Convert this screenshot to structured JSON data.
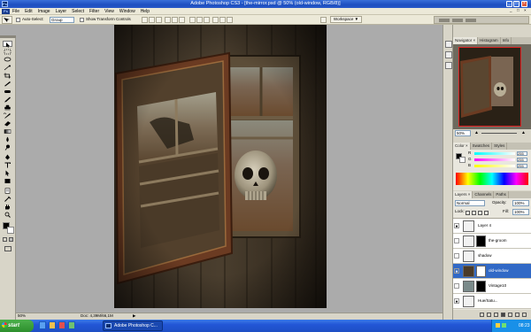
{
  "window": {
    "title": "Adobe Photoshop CS3 - [the-mirror.psd @ 50% (old-window, RGB/8)]",
    "controls": [
      "_",
      "□",
      "×"
    ]
  },
  "menubar": {
    "logo": "Ps",
    "items": [
      "File",
      "Edit",
      "Image",
      "Layer",
      "Select",
      "Filter",
      "View",
      "Window",
      "Help"
    ],
    "doc_controls": [
      "_",
      "□",
      "×"
    ]
  },
  "options": {
    "auto_select_label": "Auto-Select:",
    "auto_select_value": "Group",
    "transform_label": "Show Transform Controls",
    "workspace_label": "Workspace ▼"
  },
  "tools": {
    "icons": [
      "move-icon",
      "marquee-icon",
      "lasso-icon",
      "magic-wand-icon",
      "crop-icon",
      "eyedropper-icon",
      "healing-icon",
      "brush-icon",
      "clone-stamp-icon",
      "history-brush-icon",
      "eraser-icon",
      "gradient-icon",
      "blur-icon",
      "dodge-icon",
      "pen-icon",
      "type-icon",
      "path-select-icon",
      "shape-icon",
      "notes-icon",
      "hand-icon",
      "zoom-icon"
    ]
  },
  "status": {
    "zoom": "50%",
    "doc_info": "Doc: 4,39M/66,1M"
  },
  "navigator": {
    "tabs": [
      "Navigator ×",
      "Histogram",
      "Info"
    ],
    "zoom": "50%"
  },
  "color": {
    "tabs": [
      "Color ×",
      "Swatches",
      "Styles"
    ],
    "r_label": "R",
    "g_label": "G",
    "b_label": "B",
    "r": "255",
    "g": "255",
    "b": "255"
  },
  "layers": {
    "tabs": [
      "Layers ×",
      "Channels",
      "Paths"
    ],
    "blend_mode": "Normal",
    "opacity_label": "Opacity:",
    "opacity": "100%",
    "lock_label": "Lock:",
    "fill_label": "Fill:",
    "fill": "100%",
    "items": [
      {
        "name": "Layer 4",
        "visible": true,
        "selected": false
      },
      {
        "name": "the-groom",
        "visible": false,
        "selected": false
      },
      {
        "name": "shadow",
        "visible": false,
        "selected": false
      },
      {
        "name": "old-window",
        "visible": true,
        "selected": true
      },
      {
        "name": "Vintage10",
        "visible": false,
        "selected": false
      },
      {
        "name": "Hue/Satu...",
        "visible": true,
        "selected": false
      }
    ]
  },
  "taskbar": {
    "start_label": "start",
    "app_label": "Adobe Photoshop C...",
    "clock": "08:23"
  },
  "colors": {
    "accent": "#316ac5",
    "taskbar": "#2256d6",
    "selected_layer": "#3169c6"
  }
}
